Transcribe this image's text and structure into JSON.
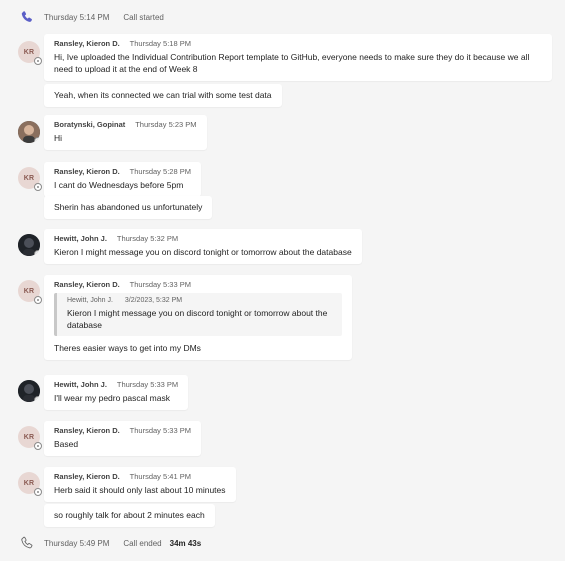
{
  "call_started": {
    "day_time": "Thursday 5:14 PM",
    "label": "Call started"
  },
  "call_ended": {
    "day_time": "Thursday 5:49 PM",
    "label": "Call ended",
    "duration": "34m 43s"
  },
  "messages": [
    {
      "avatar": "KR",
      "author": "Ransley, Kieron D.",
      "time": "Thursday 5:18 PM",
      "text": "Hi, Ive uploaded the Individual Contribution Report template to GitHub, everyone needs to make sure they do it because we all need to upload it at the end of Week 8",
      "followup": "Yeah, when its connected we can trial with some test data"
    },
    {
      "avatar": "photo",
      "author": "Boratynski, Gopinat",
      "time": "Thursday 5:23 PM",
      "text": "Hi"
    },
    {
      "avatar": "KR",
      "author": "Ransley, Kieron D.",
      "time": "Thursday 5:28 PM",
      "text": "I cant do Wednesdays before 5pm",
      "followup": "Sherin has abandoned us unfortunately"
    },
    {
      "avatar": "photo",
      "author": "Hewitt, John J.",
      "time": "Thursday 5:32 PM",
      "text": "Kieron I might message you on discord tonight or tomorrow about the database"
    },
    {
      "avatar": "KR",
      "author": "Ransley, Kieron D.",
      "time": "Thursday 5:33 PM",
      "quote": {
        "author": "Hewitt, John J.",
        "time": "3/2/2023, 5:32 PM",
        "text": "Kieron I might message you on discord tonight or tomorrow about the database"
      },
      "text": "Theres easier ways to get into my DMs"
    },
    {
      "avatar": "photo",
      "author": "Hewitt, John J.",
      "time": "Thursday 5:33 PM",
      "text": "I'll wear my pedro pascal mask"
    },
    {
      "avatar": "KR",
      "author": "Ransley, Kieron D.",
      "time": "Thursday 5:33 PM",
      "text": "Based"
    },
    {
      "avatar": "KR",
      "author": "Ransley, Kieron D.",
      "time": "Thursday 5:41 PM",
      "text": "Herb said it should only last about 10 minutes",
      "followup": "so roughly talk for about 2 minutes each"
    }
  ]
}
